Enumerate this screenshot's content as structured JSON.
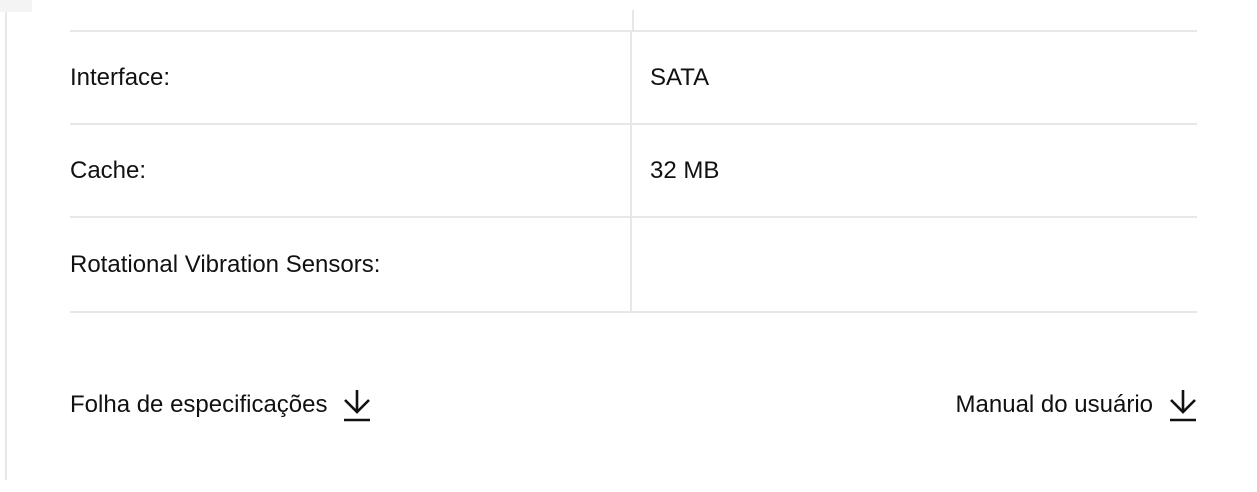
{
  "specs": [
    {
      "label": "Interface:",
      "value": "SATA"
    },
    {
      "label": "Cache:",
      "value": "32 MB"
    },
    {
      "label": "Rotational Vibration Sensors:",
      "value": ""
    }
  ],
  "downloads": {
    "spec_sheet_label": "Folha de especificações",
    "spec_sheet_icon": "download-arrow-icon",
    "manual_label": "Manual do usuário",
    "manual_icon": "download-arrow-icon"
  }
}
